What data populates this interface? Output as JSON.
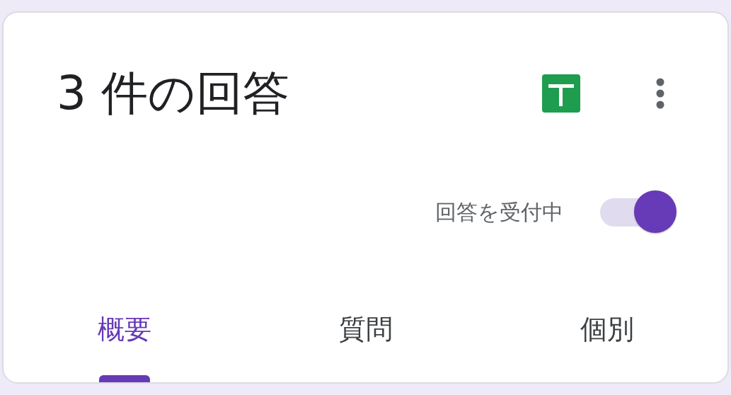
{
  "header": {
    "title": "3 件の回答"
  },
  "accepting": {
    "label": "回答を受付中",
    "on": true
  },
  "tabs": [
    {
      "label": "概要",
      "selected": true
    },
    {
      "label": "質問",
      "selected": false
    },
    {
      "label": "個別",
      "selected": false
    }
  ]
}
